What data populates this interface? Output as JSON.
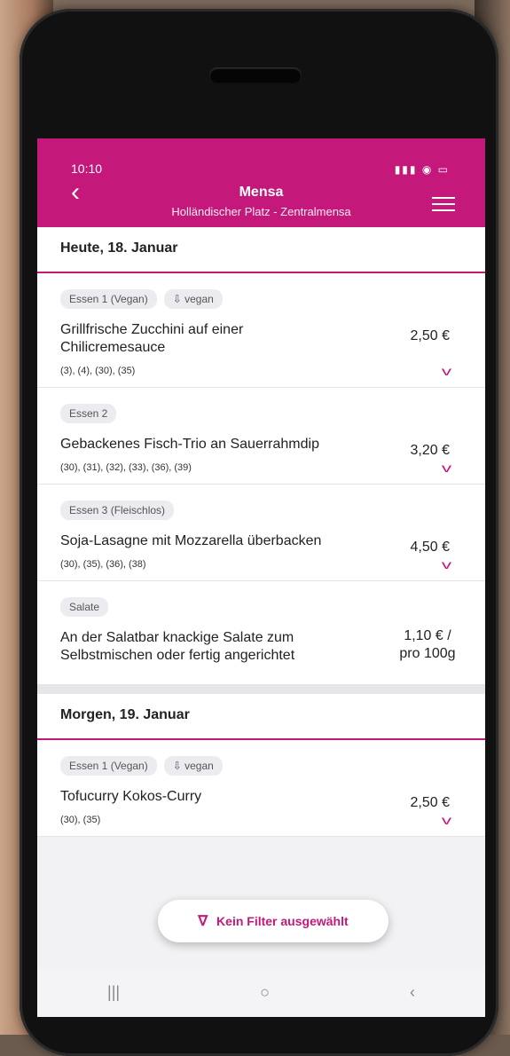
{
  "status": {
    "time": "10:10",
    "icons": "▮▮▮ ◉ ▭"
  },
  "header": {
    "back_icon": "‹",
    "title": "Mensa",
    "subtitle": "Holländischer Platz - Zentralmensa"
  },
  "days": [
    {
      "label": "Heute, 18. Januar",
      "items": [
        {
          "chips": [
            "Essen 1 (Vegan)",
            "vegan"
          ],
          "name": "Grillfrische Zucchini auf einer Chilicremesauce",
          "codes": "(3), (4), (30), (35)",
          "price": "2,50 €"
        },
        {
          "chips": [
            "Essen 2"
          ],
          "name": "Gebackenes Fisch-Trio an Sauerrahmdip",
          "codes": "(30), (31), (32), (33), (36), (39)",
          "price": "3,20 €"
        },
        {
          "chips": [
            "Essen 3 (Fleischlos)"
          ],
          "name": "Soja-Lasagne mit Mozzarella überbacken",
          "codes": "(30), (35), (36), (38)",
          "price": "4,50 €"
        },
        {
          "chips": [
            "Salate"
          ],
          "name": "An der Salatbar knackige Salate zum Selbstmischen oder fertig angerichtet",
          "codes": "",
          "price": "1,10 € / pro 100g"
        }
      ]
    },
    {
      "label": "Morgen, 19. Januar",
      "items": [
        {
          "chips": [
            "Essen 1 (Vegan)",
            "vegan"
          ],
          "name": "Tofucurry Kokos-Curry",
          "codes": "(30), (35)",
          "price": "2,50 €"
        }
      ]
    }
  ],
  "filter": {
    "label": "Kein Filter ausgewählt",
    "icon": "filter-icon"
  },
  "navbar": {
    "recents": "|||",
    "home": "○",
    "back": "‹"
  },
  "colors": {
    "accent": "#c4187a"
  }
}
